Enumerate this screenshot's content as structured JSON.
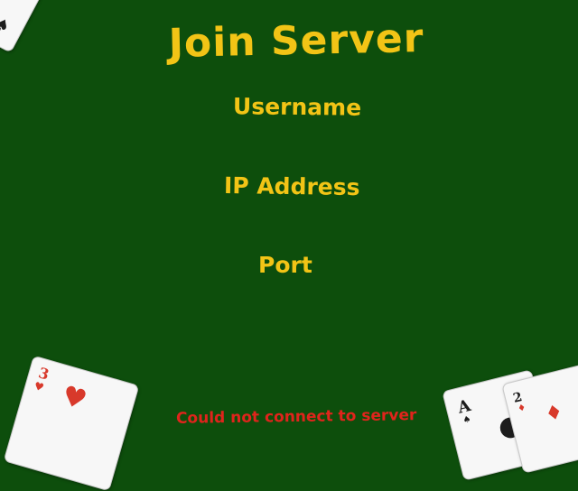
{
  "title": "Join Server",
  "fields": {
    "username_label": "Username",
    "ip_label": "IP Address",
    "port_label": "Port"
  },
  "status": {
    "error_text": "Could not connect to server",
    "error_color": "#e0241c"
  },
  "colors": {
    "background": "#0d4e0c",
    "accent": "#f2c416"
  },
  "decor_cards": [
    {
      "rank": "",
      "suit": "spade",
      "icon": "spade-icon"
    },
    {
      "rank": "3",
      "suit": "heart",
      "icon": "heart-icon"
    },
    {
      "rank": "A",
      "suit": "spade",
      "icon": "spade-icon"
    },
    {
      "rank": "2",
      "suit": "diamond",
      "icon": "diamond-icon"
    }
  ]
}
